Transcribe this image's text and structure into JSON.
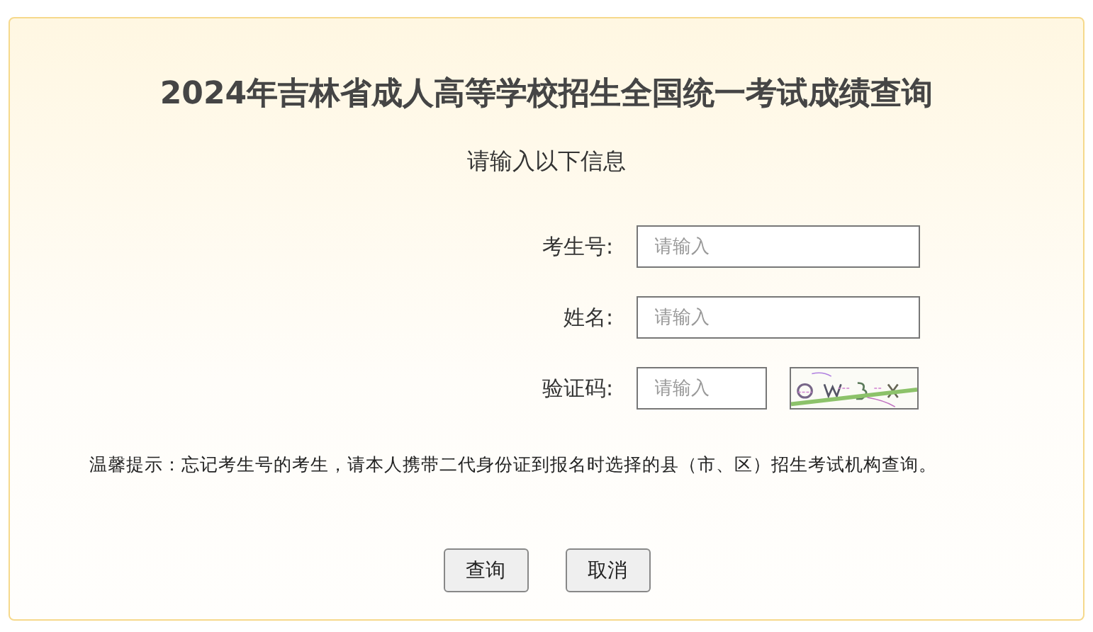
{
  "title": "2024年吉林省成人高等学校招生全国统一考试成绩查询",
  "subtitle": "请输入以下信息",
  "fields": [
    {
      "kind": "text",
      "label": "考生号:",
      "placeholder": "请输入"
    },
    {
      "kind": "text",
      "label": "姓名:",
      "placeholder": "请输入"
    },
    {
      "kind": "captcha",
      "label": "验证码:",
      "placeholder": "请输入"
    }
  ],
  "notice": "温馨提示：忘记考生号的考生，请本人携带二代身份证到报名时选择的县（市、区）招生考试机构查询。",
  "buttons": [
    "查询",
    "取消"
  ]
}
